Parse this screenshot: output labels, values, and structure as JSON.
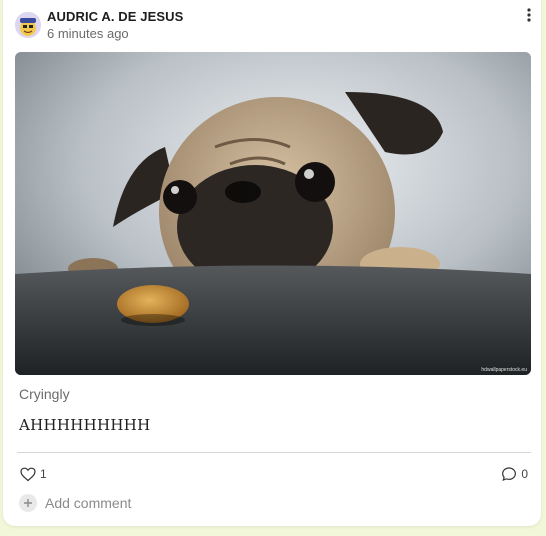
{
  "post": {
    "author": "AUDRIC A. DE JESUS",
    "time": "6 minutes ago",
    "photo_alt": "pug peeking over a table at a cookie",
    "photo_watermark": "hdwallpaperstock.eu",
    "caption": "Cryingly",
    "body": "AHHHHHHHHH",
    "likes": "1",
    "comments": "0",
    "add_comment_placeholder": "Add comment"
  },
  "icons": {
    "avatar": "cartoon-avatar-icon",
    "menu": "more-vertical-icon",
    "like": "heart-icon",
    "comment": "comment-bubble-icon",
    "add": "plus-icon"
  },
  "colors": {
    "page_background": "#f3f7d9",
    "card_background": "#ffffff",
    "muted_text": "#6b6b6b"
  }
}
